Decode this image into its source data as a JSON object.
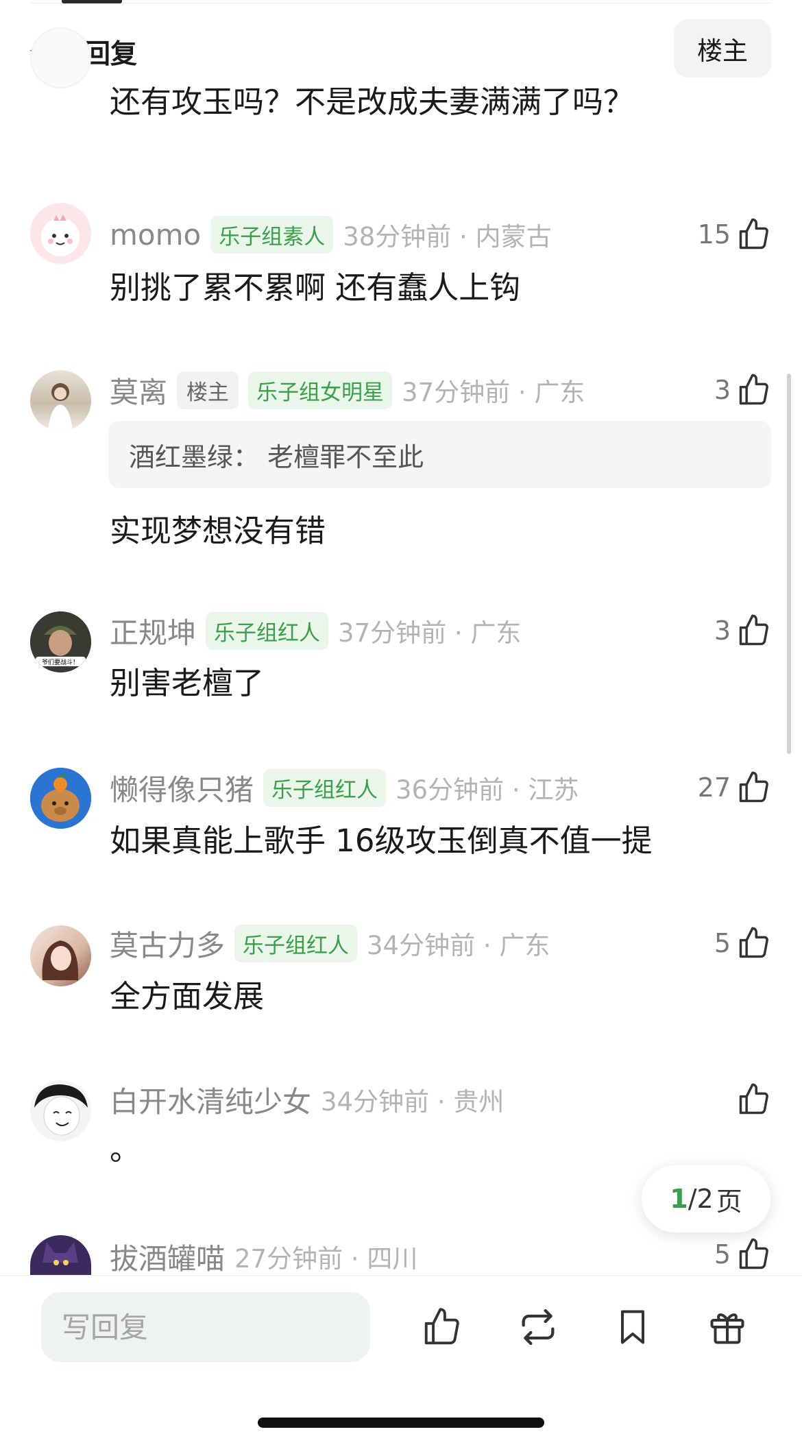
{
  "section": {
    "title": "全部回复",
    "filter_label": "楼主"
  },
  "comments": [
    {
      "text": "还有攻玉吗？不是改成夫妻满满了吗？"
    },
    {
      "name": "momo",
      "badge": "乐子组素人",
      "meta": "38分钟前 · 内蒙古",
      "likes": "15",
      "text": "别挑了累不累啊 还有蠢人上钩"
    },
    {
      "name": "莫离",
      "op_badge": "楼主",
      "badge": "乐子组女明星",
      "meta": "37分钟前 · 广东",
      "likes": "3",
      "quote": "酒红墨绿： 老檀罪不至此",
      "text": "实现梦想没有错"
    },
    {
      "name": "正规坤",
      "badge": "乐子组红人",
      "meta": "37分钟前 · 广东",
      "likes": "3",
      "avatar_caption": "爷们要战斗！",
      "text": "别害老檀了"
    },
    {
      "name": "懒得像只猪",
      "badge": "乐子组红人",
      "meta": "36分钟前 · 江苏",
      "likes": "27",
      "text": "如果真能上歌手 16级攻玉倒真不值一提"
    },
    {
      "name": "莫古力多",
      "badge": "乐子组红人",
      "meta": "34分钟前 · 广东",
      "likes": "5",
      "text": "全方面发展"
    },
    {
      "name": "白开水清纯少女",
      "meta": "34分钟前 · 贵州",
      "text": "。"
    },
    {
      "name": "拔酒罐喵",
      "meta": "27分钟前 · 四川",
      "likes": "5"
    }
  ],
  "pager": {
    "current": "1",
    "total": "/2",
    "unit": "页"
  },
  "bottom_bar": {
    "reply_placeholder": "写回复"
  },
  "colors": {
    "accent_green": "#3a9f4a",
    "badge_bg": "#eaf6ea",
    "meta_gray": "#b3b3b3"
  }
}
